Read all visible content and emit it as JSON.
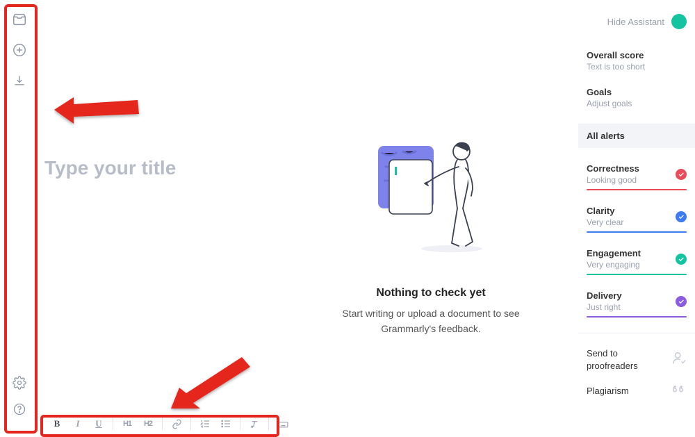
{
  "editor": {
    "title_placeholder": "Type your title"
  },
  "empty_state": {
    "heading": "Nothing to check yet",
    "subtext": "Start writing or upload a document to see Grammarly's feedback."
  },
  "right_panel": {
    "hide_label": "Hide Assistant",
    "score": {
      "heading": "Overall score",
      "subtext": "Text is too short"
    },
    "goals": {
      "heading": "Goals",
      "subtext": "Adjust goals"
    },
    "all_alerts_label": "All alerts",
    "metrics": [
      {
        "heading": "Correctness",
        "subtext": "Looking good",
        "color": "#ea4b59",
        "badge": "#ea4b59"
      },
      {
        "heading": "Clarity",
        "subtext": "Very clear",
        "color": "#3d7cf0",
        "badge": "#3d7cf0"
      },
      {
        "heading": "Engagement",
        "subtext": "Very engaging",
        "color": "#14c4a0",
        "badge": "#14c4a0"
      },
      {
        "heading": "Delivery",
        "subtext": "Just right",
        "color": "#8b5ce0",
        "badge": "#8b5ce0"
      }
    ],
    "actions": [
      {
        "label": "Send to proofreaders"
      },
      {
        "label": "Plagiarism"
      }
    ]
  },
  "toolbar": {
    "bold": "B",
    "italic": "I",
    "underline": "U",
    "h1": "H1",
    "h2": "H2"
  },
  "colors": {
    "accent_green": "#14c4a0",
    "highlight_red": "#e4261f"
  }
}
